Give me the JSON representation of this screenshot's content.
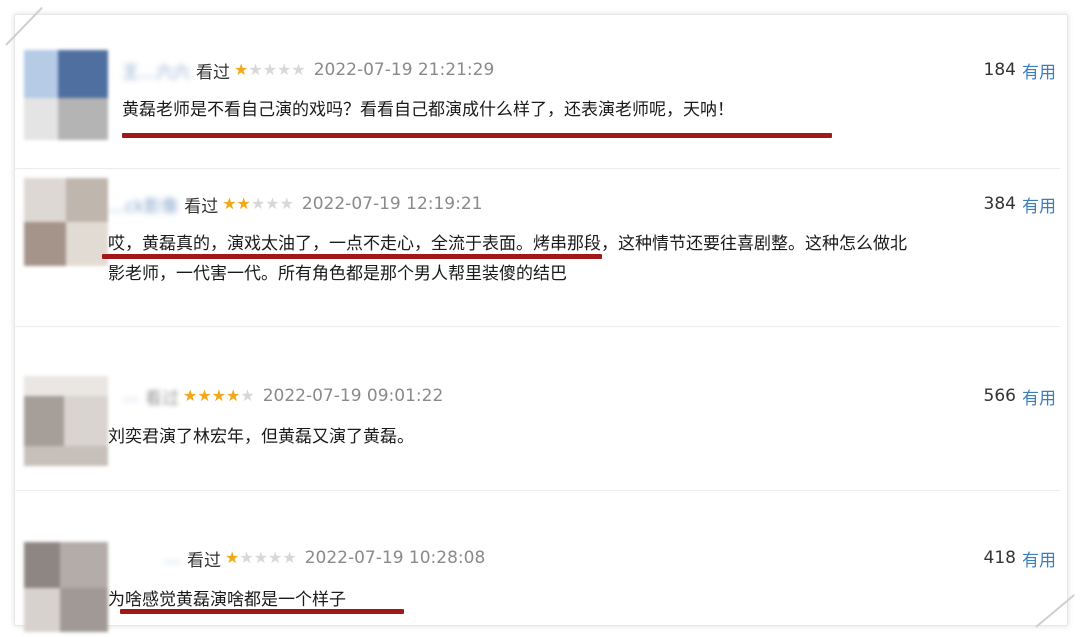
{
  "comments": [
    {
      "user": "王…六六",
      "status": "看过",
      "stars": [
        true,
        false,
        false,
        false,
        false
      ],
      "date": "2022-07-19 21:21:29",
      "votes": "184",
      "vote_label": "有用",
      "lines": [
        "黄磊老师是不看自己演的戏吗？看看自己都演成什么样了，还表演老师呢，天呐！"
      ]
    },
    {
      "user": "…ck影像",
      "status": "看过",
      "stars": [
        true,
        true,
        false,
        false,
        false
      ],
      "date": "2022-07-19 12:19:21",
      "votes": "384",
      "vote_label": "有用",
      "lines": [
        "哎，黄磊真的，演戏太油了，一点不走心，全流于表面。烤串那段，这种情节还要往喜剧整。这种怎么做北",
        "影老师，一代害一代。所有角色都是那个男人帮里装傻的结巴"
      ]
    },
    {
      "user": "…",
      "status": "看过",
      "stars": [
        true,
        true,
        true,
        true,
        false
      ],
      "date": "2022-07-19 09:01:22",
      "votes": "566",
      "vote_label": "有用",
      "lines": [
        "刘奕君演了林宏年，但黄磊又演了黄磊。"
      ]
    },
    {
      "user": "…",
      "status": "看过",
      "stars": [
        true,
        false,
        false,
        false,
        false
      ],
      "date": "2022-07-19 10:28:08",
      "votes": "418",
      "vote_label": "有用",
      "lines": [
        "为啥感觉黄磊演啥都是一个样子"
      ]
    }
  ],
  "colors": {
    "star_on": "#f2a818",
    "star_off": "#d8d8d8",
    "link": "#3b7ec0",
    "underline": "#a01818"
  }
}
